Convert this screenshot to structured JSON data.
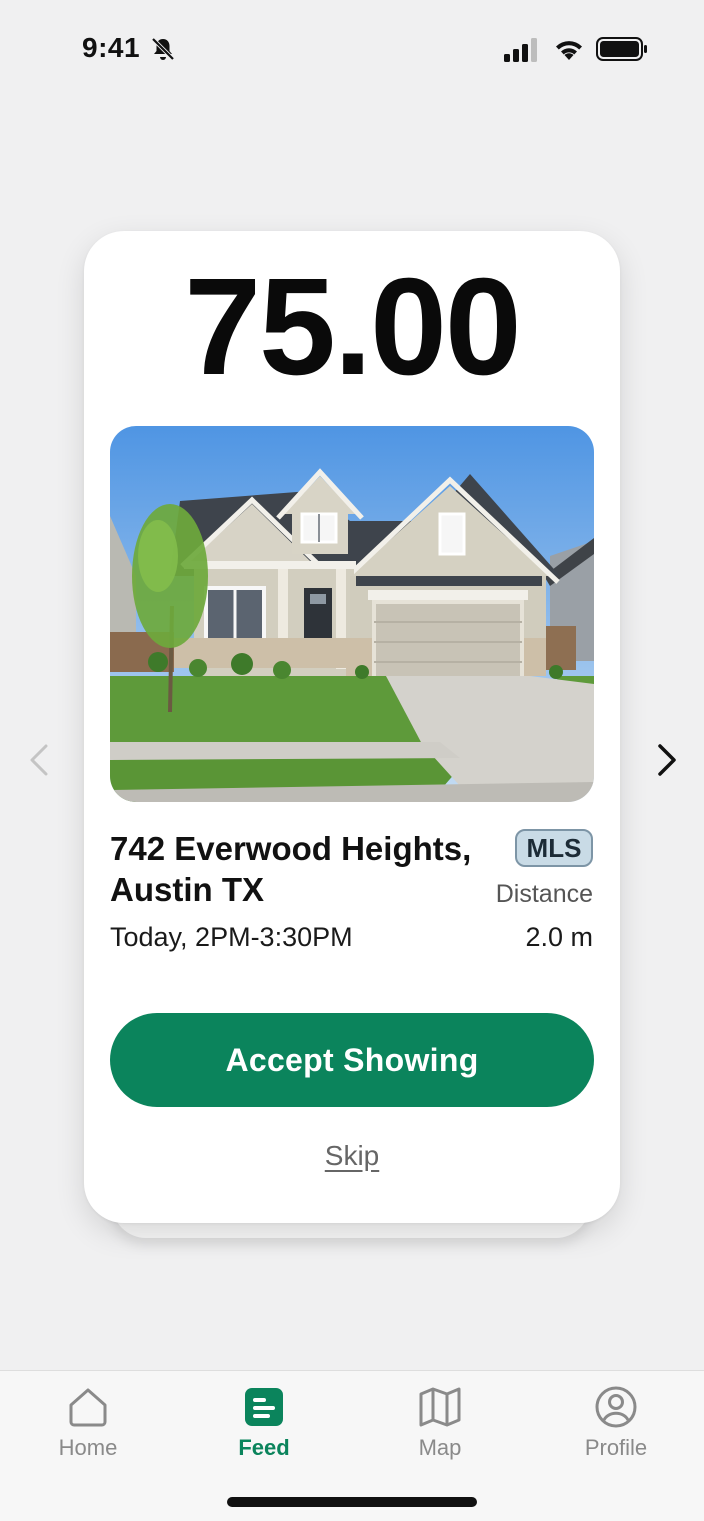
{
  "status_bar": {
    "time": "9:41",
    "icons": [
      "bell-slash-icon",
      "signal-icon",
      "wifi-icon",
      "battery-icon"
    ]
  },
  "listing": {
    "price": "75.00",
    "photo": "house-photo",
    "address": "742 Everwood Heights, Austin TX",
    "badge": "MLS",
    "distance_label": "Distance",
    "time_window": "Today, 2PM-3:30PM",
    "distance_value": "2.0 m"
  },
  "actions": {
    "accept_label": "Accept Showing",
    "skip_label": "Skip",
    "prev_icon": "chevron-left-icon",
    "next_icon": "chevron-right-icon"
  },
  "tab_bar": {
    "tabs": [
      {
        "label": "Home",
        "icon": "home-icon",
        "active": false
      },
      {
        "label": "Feed",
        "icon": "feed-icon",
        "active": true
      },
      {
        "label": "Map",
        "icon": "map-icon",
        "active": false
      },
      {
        "label": "Profile",
        "icon": "profile-icon",
        "active": false
      }
    ]
  },
  "colors": {
    "accent": "#0b845c",
    "background": "#f0f0f1",
    "badge_bg": "#c9dbe6"
  }
}
